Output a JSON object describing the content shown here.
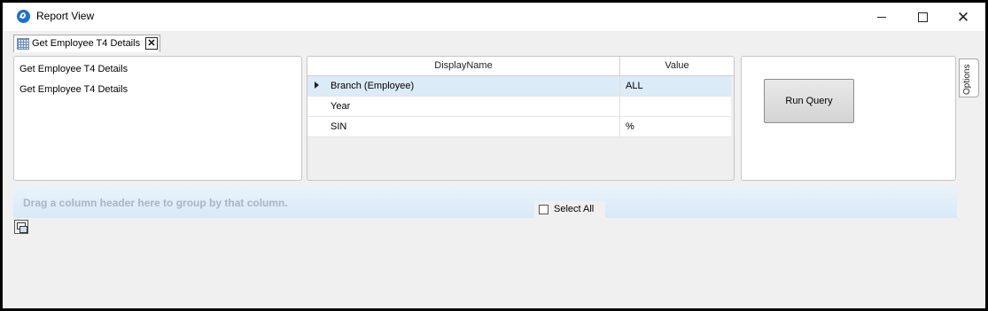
{
  "window": {
    "title": "Report View",
    "app_icon": "report-app-icon",
    "minimize_icon": "minimize-icon",
    "maximize_icon": "maximize-icon",
    "close_icon": "close-icon",
    "close_glyph": "✕"
  },
  "tabs": [
    {
      "label": "Get Employee T4 Details",
      "icon": "grid-icon",
      "close_glyph": "✕",
      "active": true
    }
  ],
  "queries": {
    "items": [
      "Get Employee T4 Details",
      "Get Employee T4 Details"
    ]
  },
  "params_grid": {
    "columns": [
      "DisplayName",
      "Value"
    ],
    "rows": [
      {
        "name": "Branch (Employee)",
        "value": "ALL",
        "selected": true
      },
      {
        "name": "Year",
        "value": ""
      },
      {
        "name": "SIN",
        "value": "%"
      }
    ]
  },
  "actions": {
    "run_query": "Run Query"
  },
  "options_tab": {
    "label": "Options"
  },
  "results": {
    "group_hint": "Drag a column header here to group by that column.",
    "select_all_label": "Select All",
    "select_all_checked": false,
    "column_chooser_icon": "column-chooser-icon"
  },
  "colors": {
    "selected_row": "#dcebf8",
    "group_bar": "#d8e9f7",
    "app_icon": "#1f6fd0"
  }
}
